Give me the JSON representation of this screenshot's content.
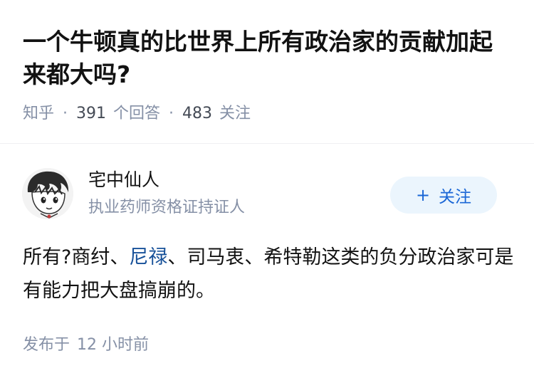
{
  "question": {
    "title": "一个牛顿真的比世界上所有政治家的贡献加起来都大吗?",
    "source": "知乎",
    "separator": "·",
    "answer_count": "391",
    "answer_label": "个回答",
    "follower_count": "483",
    "follower_label": "关注"
  },
  "answer": {
    "author": {
      "name": "宅中仙人",
      "bio": "执业药师资格证持证人",
      "avatar_icon": "cartoon-avatar"
    },
    "follow_button": {
      "icon": "+",
      "label": "关注"
    },
    "content": {
      "part1": "所有?商纣、",
      "link": "尼禄",
      "part2": "、司马衷、希特勒这类的负分政治家可是有能力把大盘搞崩的。"
    },
    "publish_label": "发布于",
    "publish_time": "12 小时前"
  },
  "colors": {
    "meta_gray": "#8590a6",
    "link_blue": "#175199",
    "follow_bg": "#ebf5fd",
    "follow_text": "#1a66d6"
  }
}
